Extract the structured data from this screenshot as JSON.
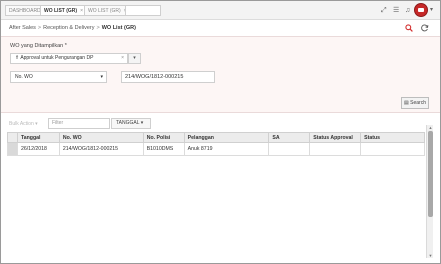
{
  "tabs": [
    {
      "label": "DASHBOARD",
      "active": false
    },
    {
      "label": "WO LIST (GR)",
      "active": true,
      "close": "×"
    },
    {
      "label": "WO LIST (GR)",
      "active": false,
      "close": "×"
    }
  ],
  "topbar_icons": [
    "expand-icon",
    "list-icon",
    "bell-icon",
    "avatar",
    "caret-down-icon"
  ],
  "breadcrumb": {
    "items": [
      "After Sales",
      "Reception & Delivery",
      "WO List (GR)"
    ],
    "separator": ">"
  },
  "actions": {
    "search_icon_color": "#d32f2f",
    "refresh_icon_color": "#555555"
  },
  "form": {
    "label": "WO yang Ditampilkan *",
    "approval_select": "Approval untuk Pengurangan DP",
    "approval_clear": "×",
    "dropdown_arrow": "▾",
    "field_select": "No. WO",
    "field_value": "214/WOG/1812-000215",
    "search_button": "Search"
  },
  "toolbar": {
    "bulk_action": "Bulk Action ▾",
    "filter_placeholder": "Filter",
    "filter_field": "TANGGAL ▾"
  },
  "table": {
    "columns": [
      "",
      "Tanggal",
      "No. WO",
      "No. Polisi",
      "Pelanggan",
      "SA",
      "Status Approval",
      "Status"
    ],
    "rows": [
      [
        "",
        "26/12/2018",
        "214/WOG/1812-000215",
        "B1010DMS",
        "Anuk 8719",
        "",
        "",
        ""
      ]
    ]
  },
  "colors": {
    "accent": "#d32f2f",
    "form_bg": "#fdf6f5",
    "header_bg": "#ececec"
  }
}
